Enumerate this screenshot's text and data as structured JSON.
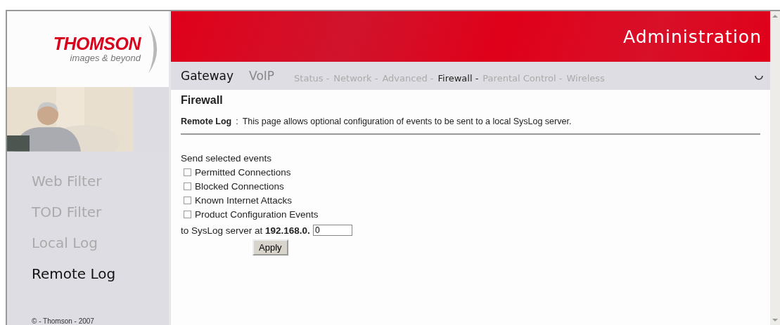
{
  "logo": {
    "brand": "THOMSON",
    "tagline": "images & beyond"
  },
  "header": {
    "title": "Administration"
  },
  "main_tabs": [
    {
      "label": "Gateway",
      "selected": true
    },
    {
      "label": "VoIP",
      "selected": false
    }
  ],
  "sub_nav": [
    {
      "label": "Status -",
      "selected": false
    },
    {
      "label": "Network -",
      "selected": false
    },
    {
      "label": "Advanced -",
      "selected": false
    },
    {
      "label": "Firewall -",
      "selected": true
    },
    {
      "label": "Parental Control -",
      "selected": false
    },
    {
      "label": "Wireless",
      "selected": false
    }
  ],
  "sidebar": {
    "items": [
      {
        "label": "Web Filter",
        "selected": false
      },
      {
        "label": "TOD Filter",
        "selected": false
      },
      {
        "label": "Local Log",
        "selected": false
      },
      {
        "label": "Remote Log",
        "selected": true
      }
    ],
    "footer": "© - Thomson - 2007"
  },
  "page": {
    "title": "Firewall",
    "intro_label": "Remote Log",
    "intro_sep": ":",
    "intro": "This page allows optional configuration of events to be sent to a local SysLog server.",
    "events_label": "Send selected events",
    "events": [
      {
        "label": "Permitted Connections",
        "checked": false
      },
      {
        "label": "Blocked Connections",
        "checked": false
      },
      {
        "label": "Known Internet Attacks",
        "checked": false
      },
      {
        "label": "Product Configuration Events",
        "checked": false
      }
    ],
    "server_label": "to SysLog server at **192.168.0.**",
    "server_value": "0",
    "apply": "Apply"
  }
}
